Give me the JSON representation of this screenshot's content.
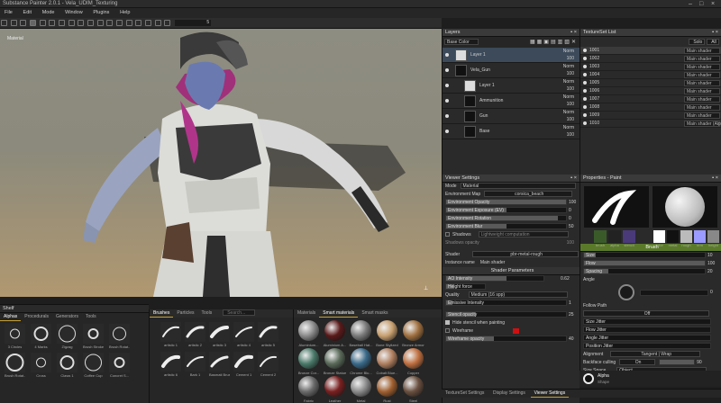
{
  "window": {
    "title": "Substance Painter 2.0.1 - Vela_UDIM_Texturing"
  },
  "menu": [
    "File",
    "Edit",
    "Mode",
    "Window",
    "Plugins",
    "Help"
  ],
  "toolbar": {
    "size_value": "5"
  },
  "viewport": {
    "label": "Material"
  },
  "layers": {
    "title": "Layers",
    "channel": "Base Color",
    "items": [
      {
        "name": "Layer 1",
        "blend": "Norm",
        "opacity": "100",
        "indent": 0
      },
      {
        "name": "Vela_Gun",
        "blend": "Norm",
        "opacity": "100",
        "indent": 0
      },
      {
        "name": "Layer 1",
        "blend": "Norm",
        "opacity": "100",
        "indent": 1
      },
      {
        "name": "Ammunition",
        "blend": "Norm",
        "opacity": "100",
        "indent": 1
      },
      {
        "name": "Gun",
        "blend": "Norm",
        "opacity": "100",
        "indent": 1
      },
      {
        "name": "Base",
        "blend": "Norm",
        "opacity": "100",
        "indent": 1
      }
    ]
  },
  "texture_set_list": {
    "title": "TextureSet List",
    "buttons": [
      "Solo",
      "All"
    ],
    "items": [
      {
        "id": "1001",
        "shader": "Main shader"
      },
      {
        "id": "1002",
        "shader": "Main shader"
      },
      {
        "id": "1003",
        "shader": "Main shader"
      },
      {
        "id": "1004",
        "shader": "Main shader"
      },
      {
        "id": "1005",
        "shader": "Main shader"
      },
      {
        "id": "1006",
        "shader": "Main shader"
      },
      {
        "id": "1007",
        "shader": "Main shader"
      },
      {
        "id": "1008",
        "shader": "Main shader"
      },
      {
        "id": "1009",
        "shader": "Main shader"
      },
      {
        "id": "1010",
        "shader": "Main shader (Alpha)"
      }
    ]
  },
  "viewer_settings": {
    "title": "Viewer Settings",
    "mode_label": "Mode",
    "mode_value": "Material",
    "env_map_label": "Environment Map",
    "env_map_value": "corsica_beach",
    "sliders": [
      {
        "label": "Environment Opacity",
        "value": "100",
        "fill": 1.0
      },
      {
        "label": "Environment Exposure (EV)",
        "value": "0",
        "fill": 0.5
      },
      {
        "label": "Environment Rotation",
        "value": "0",
        "fill": 0.93
      },
      {
        "label": "Environment Blur",
        "value": "50",
        "fill": 0.5
      }
    ],
    "shadows_label": "Shadows",
    "shadows_value": "Lightweight computation",
    "shadows_opacity_label": "Shadows opacity",
    "shadows_opacity_value": "100",
    "shader_label": "Shader",
    "shader_value": "pbr-metal-rough",
    "instance_label": "Instance name",
    "instance_value": "Main shader",
    "shader_params_title": "Shader Parameters",
    "ao_label": "AO Intensity",
    "ao_value": "0.62",
    "height_label": "Height force",
    "quality_label": "Quality",
    "quality_value": "Medium (16 spp)",
    "emissive_label": "Emissive Intensity",
    "emissive_value": "1",
    "stencil_label": "Stencil opacity",
    "stencil_value": "25",
    "hide_stencil_label": "Hide stencil when painting",
    "wireframe_label": "Wireframe",
    "wireframe_opacity_label": "Wireframe opacity",
    "wireframe_opacity_value": "40"
  },
  "properties": {
    "title": "Properties - Paint",
    "brush_slots": [
      "brush",
      "alpha",
      "stencil"
    ],
    "material_slots": [
      "color",
      "metal",
      "rough",
      "nrm",
      "height"
    ],
    "brush_title": "Brush",
    "params": [
      {
        "label": "Size",
        "value": "10",
        "fill": 0.1
      },
      {
        "label": "Flow",
        "value": "100",
        "fill": 1.0
      },
      {
        "label": "Spacing",
        "value": "20",
        "fill": 0.2
      }
    ],
    "angle_label": "Angle",
    "angle_value": "0",
    "follow_path_label": "Follow Path",
    "follow_path_value": "Off",
    "jitters": [
      "Size Jitter",
      "Flow Jitter",
      "Angle Jitter",
      "Position Jitter"
    ],
    "alignment_label": "Alignment",
    "alignment_value": "Tangent | Wrap",
    "backface_label": "Backface culling",
    "backface_value": "On",
    "backface_num": "90",
    "size_space_label": "Size Space",
    "size_space_value": "Object",
    "alpha_label": "Alpha",
    "alpha_sub": "Shape"
  },
  "shelf": {
    "title": "Shelf",
    "tabs": [
      "Alphas",
      "Procedurals",
      "Generators",
      "Tools"
    ],
    "items": [
      "3 Circles",
      "4 Marks",
      "Zigzag",
      "Brush Stroke",
      "Brush Rotat...",
      "Brush Rotat...",
      "Cross",
      "Claws 1",
      "Coffee Cup",
      "Concret S..."
    ]
  },
  "brushes": {
    "tabs": [
      "Brushes",
      "Particles",
      "Tools"
    ],
    "search": "Search...",
    "items": [
      "artistic 1",
      "artistic 2",
      "artistic 3",
      "artistic 4",
      "artistic 5",
      "artistic 6",
      "Bark 1",
      "Basmati Brush",
      "Cement 1",
      "Cement 2"
    ]
  },
  "materials": {
    "tabs": [
      "Materials",
      "Smart materials",
      "Smart masks"
    ],
    "items": [
      {
        "name": "Aluminium...",
        "color": "#8a8a8a"
      },
      {
        "name": "Aluminium A...",
        "color": "#5a1a1a"
      },
      {
        "name": "Baseball Hat...",
        "color": "#7a7a7a"
      },
      {
        "name": "Bone Stylized",
        "color": "#c8a070"
      },
      {
        "name": "Bronze Armor",
        "color": "#a07040"
      },
      {
        "name": "Bronze Cor...",
        "color": "#4a7a6a"
      },
      {
        "name": "Bronze Statue",
        "color": "#5a6a5a"
      },
      {
        "name": "Chrome Blu...",
        "color": "#3a6a8a"
      },
      {
        "name": "Cobalt Blue...",
        "color": "#b08060"
      },
      {
        "name": "Copper",
        "color": "#c07040"
      },
      {
        "name": "Fabric",
        "color": "#6a6a6a"
      },
      {
        "name": "Leather",
        "color": "#7a2020"
      },
      {
        "name": "Metal",
        "color": "#8a8a8a"
      },
      {
        "name": "Rust",
        "color": "#a06030"
      },
      {
        "name": "Steel",
        "color": "#6a5040"
      }
    ]
  },
  "bottom_tabs": [
    "TextureSet Settings",
    "Display Settings",
    "Viewer Settings"
  ]
}
